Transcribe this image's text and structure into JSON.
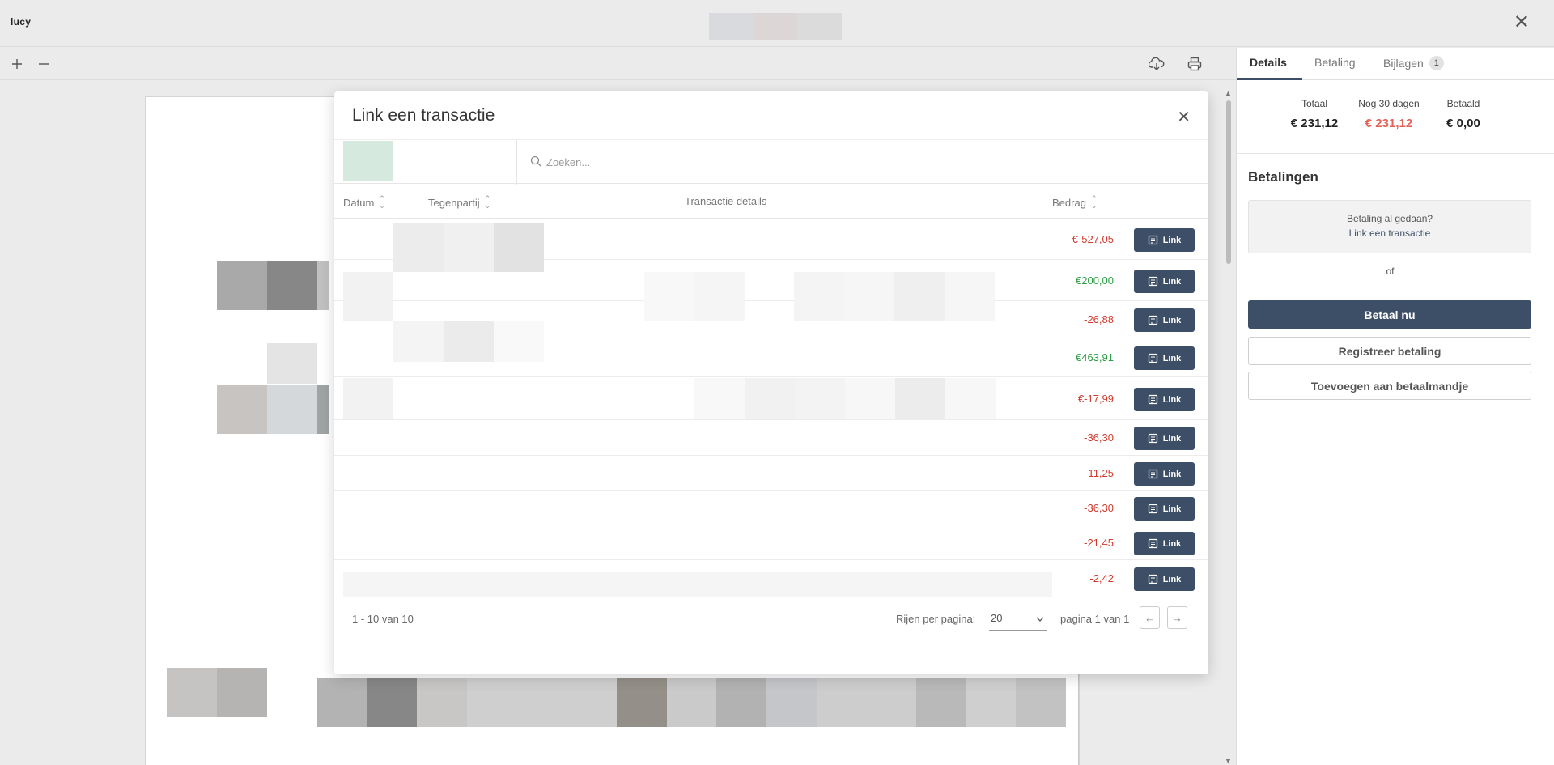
{
  "app": {
    "logo": "lucy"
  },
  "icons": {
    "window_close": "close-icon",
    "zoom_in": "plus-icon",
    "zoom_out": "minus-icon",
    "download": "cloud-download-icon",
    "print": "printer-icon"
  },
  "modal": {
    "title": "Link een transactie",
    "search_placeholder": "Zoeken...",
    "columns": {
      "date": "Datum",
      "counterparty": "Tegenpartij",
      "details": "Transactie details",
      "amount": "Bedrag"
    },
    "link_label": "Link",
    "rows": [
      {
        "amount": "€-527,05",
        "sign": "neg"
      },
      {
        "amount": "€200,00",
        "sign": "pos"
      },
      {
        "amount": "-26,88",
        "sign": "neg"
      },
      {
        "amount": "€463,91",
        "sign": "pos"
      },
      {
        "amount": "€-17,99",
        "sign": "neg"
      },
      {
        "amount": "-36,30",
        "sign": "neg"
      },
      {
        "amount": "-11,25",
        "sign": "neg"
      },
      {
        "amount": "-36,30",
        "sign": "neg"
      },
      {
        "amount": "-21,45",
        "sign": "neg"
      },
      {
        "amount": "-2,42",
        "sign": "neg"
      }
    ],
    "footer": {
      "range": "1 - 10 van 10",
      "rows_per_page_label": "Rijen per pagina:",
      "rows_per_page_value": "20",
      "page_info": "pagina 1 van 1"
    }
  },
  "panel": {
    "tabs": [
      {
        "label": "Details"
      },
      {
        "label": "Betaling"
      },
      {
        "label": "Bijlagen",
        "badge": "1"
      }
    ],
    "summary": {
      "total_label": "Totaal",
      "total_value": "€ 231,12",
      "due_label": "Nog 30 dagen",
      "due_value": "€ 231,12",
      "paid_label": "Betaald",
      "paid_value": "€ 0,00"
    },
    "payments_title": "Betalingen",
    "paid_question": "Betaling al gedaan?",
    "paid_link": "Link een transactie",
    "or": "of",
    "pay_now": "Betaal nu",
    "register_payment": "Registreer betaling",
    "add_to_basket": "Toevoegen aan betaalmandje"
  },
  "colors": {
    "primary": "#3d4f66",
    "negative": "#d0392b",
    "positive": "#2e9e46",
    "due": "#e0645a"
  }
}
